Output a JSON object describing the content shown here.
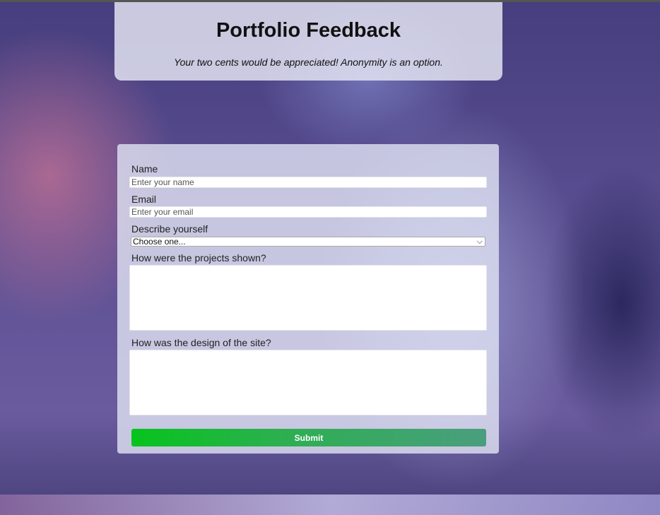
{
  "header": {
    "title": "Portfolio Feedback",
    "subtitle": "Your two cents would be appreciated! Anonymity is an option."
  },
  "form": {
    "name_label": "Name",
    "name_placeholder": "Enter your name",
    "email_label": "Email",
    "email_placeholder": "Enter your email",
    "describe_label": "Describe yourself",
    "describe_selected": "Choose one...",
    "projects_label": "How were the projects shown?",
    "design_label": "How was the design of the site?",
    "submit_label": "Submit"
  }
}
